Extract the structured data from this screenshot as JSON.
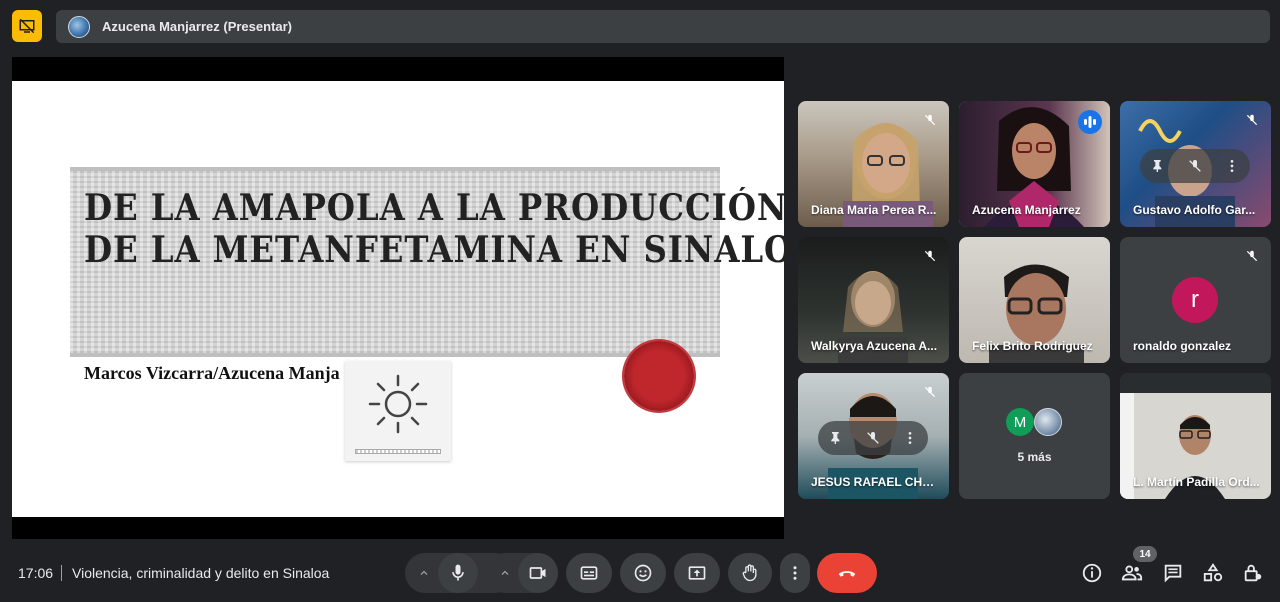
{
  "header": {
    "presenter_label": "Azucena Manjarrez (Presentar)"
  },
  "slide": {
    "title_line1": "DE LA AMAPOLA A LA PRODUCCIÓN",
    "title_line2": "DE LA METANFETAMINA EN SINALOA",
    "authors": "Marcos Vizcarra/Azucena Manja"
  },
  "participants": [
    {
      "name": "Diana Maria Perea R...",
      "muted": true
    },
    {
      "name": "Azucena Manjarrez",
      "speaking": true
    },
    {
      "name": "Gustavo Adolfo Gar...",
      "muted": true
    },
    {
      "name": "Walkyrya Azucena A...",
      "muted": true
    },
    {
      "name": "Felix Brito Rodriguez",
      "muted": false
    },
    {
      "name": "ronaldo gonzalez",
      "muted": true,
      "avatar_letter": "r",
      "avatar_color": "#c2185b"
    },
    {
      "name": "JESUS RAFAEL CHA...",
      "muted": true
    },
    {
      "more_label": "5 más",
      "avatar_letter": "M",
      "avatar_color": "#0f9d58"
    },
    {
      "name": "L. Martín Padilla Ord...",
      "muted": false
    }
  ],
  "footer": {
    "time": "17:06",
    "meeting_title": "Violencia, criminalidad y delito en Sinaloa",
    "participant_count": "14"
  },
  "colors": {
    "accent": "#8ab4f8",
    "end_call": "#ea4335",
    "present_badge": "#fbbc04"
  }
}
